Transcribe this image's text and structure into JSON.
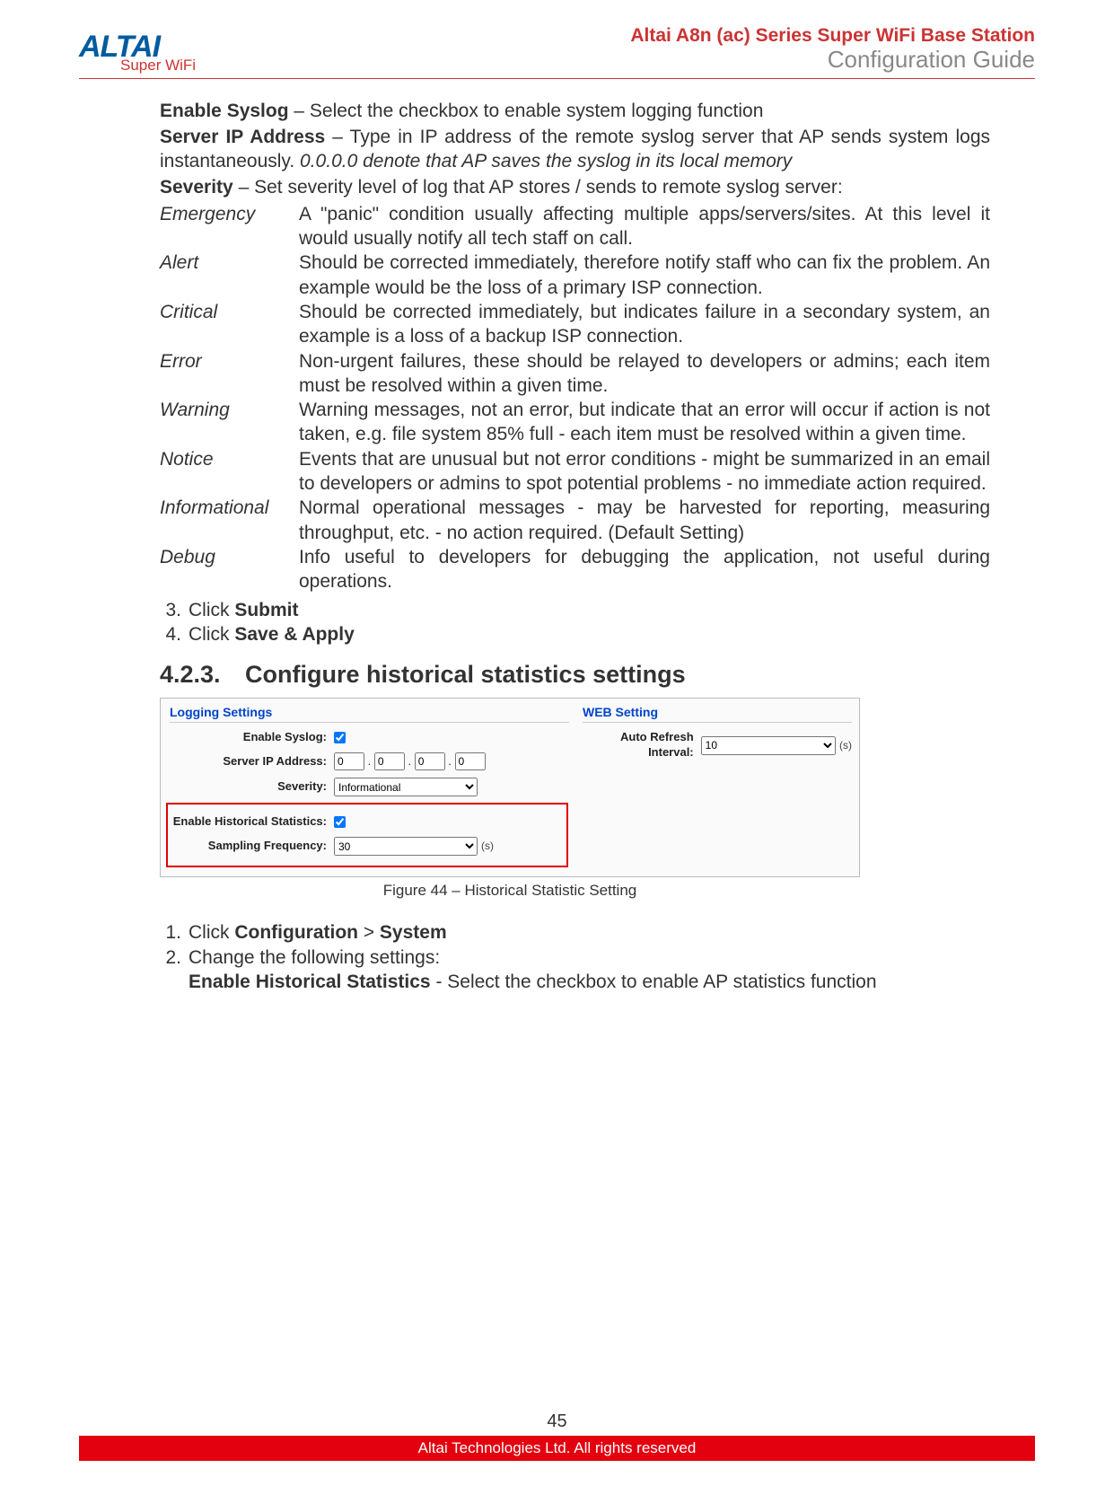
{
  "header": {
    "logo_main": "ALTAI",
    "logo_sub": "Super WiFi",
    "title1": "Altai A8n (ac) Series Super WiFi Base Station",
    "title2": "Configuration Guide"
  },
  "body": {
    "enable_syslog": {
      "label": "Enable Syslog",
      "text": " – Select the checkbox to enable system logging function"
    },
    "server_ip": {
      "label": "Server IP Address",
      "text_a": " – Type in IP address of the remote syslog server that AP sends system logs instantaneously. ",
      "italic": "0.0.0.0 denote that AP saves the syslog in its local memory"
    },
    "severity": {
      "label": "Severity",
      "text": " – Set severity level of log that AP stores / sends to remote syslog server:"
    },
    "levels": [
      {
        "name": "Emergency",
        "desc": "A \"panic\" condition usually affecting multiple apps/servers/sites. At this level it would usually notify all tech staff on call."
      },
      {
        "name": "Alert",
        "desc": "Should be corrected immediately, therefore notify staff who can fix the problem. An example would be the loss of a primary ISP connection."
      },
      {
        "name": "Critical",
        "desc": "Should be corrected immediately, but indicates failure in a secondary system, an example is a loss of a backup ISP connection."
      },
      {
        "name": "Error",
        "desc": "Non-urgent failures, these should be relayed to developers or admins; each item must be resolved within a given time."
      },
      {
        "name": "Warning",
        "desc": "Warning messages, not an error, but indicate that an error will occur if action is not taken, e.g. file system 85% full - each item must be resolved within a given time."
      },
      {
        "name": "Notice",
        "desc": "Events that are unusual but not error conditions - might be summarized in an email to developers or admins to spot potential problems - no immediate action required."
      },
      {
        "name": "Informational",
        "desc": "Normal operational messages - may be harvested for reporting, measuring throughput, etc. - no action required. (Default Setting)"
      },
      {
        "name": "Debug",
        "desc": "Info useful to developers for debugging the application, not useful during operations."
      }
    ],
    "step3": {
      "num": "3.",
      "pre": "Click ",
      "bold": "Submit"
    },
    "step4": {
      "num": "4.",
      "pre": "Click ",
      "bold": "Save & Apply"
    }
  },
  "section": {
    "num": "4.2.3.",
    "title": "Configure historical statistics settings"
  },
  "figure": {
    "left_title": "Logging Settings",
    "right_title": "WEB Setting",
    "enable_syslog_label": "Enable Syslog:",
    "server_ip_label": "Server IP Address:",
    "ip": [
      "0",
      "0",
      "0",
      "0"
    ],
    "severity_label": "Severity:",
    "severity_value": "Informational",
    "hist_label": "Enable Historical Statistics:",
    "samp_label": "Sampling Frequency:",
    "samp_value": "30",
    "samp_suffix": "(s)",
    "auto_label": "Auto Refresh Interval:",
    "auto_value": "10",
    "auto_suffix": "(s)",
    "caption": "Figure 44 – Historical Statistic Setting"
  },
  "steps2": {
    "s1": {
      "num": "1.",
      "pre": "Click ",
      "b1": "Configuration",
      "mid": " > ",
      "b2": "System"
    },
    "s2": {
      "num": "2.",
      "text": "Change the following settings:"
    },
    "s2b": {
      "bold": "Enable Historical Statistics",
      "text": " - Select the checkbox to enable AP statistics function"
    }
  },
  "footer": {
    "page": "45",
    "bar": "Altai Technologies Ltd. All rights reserved"
  }
}
